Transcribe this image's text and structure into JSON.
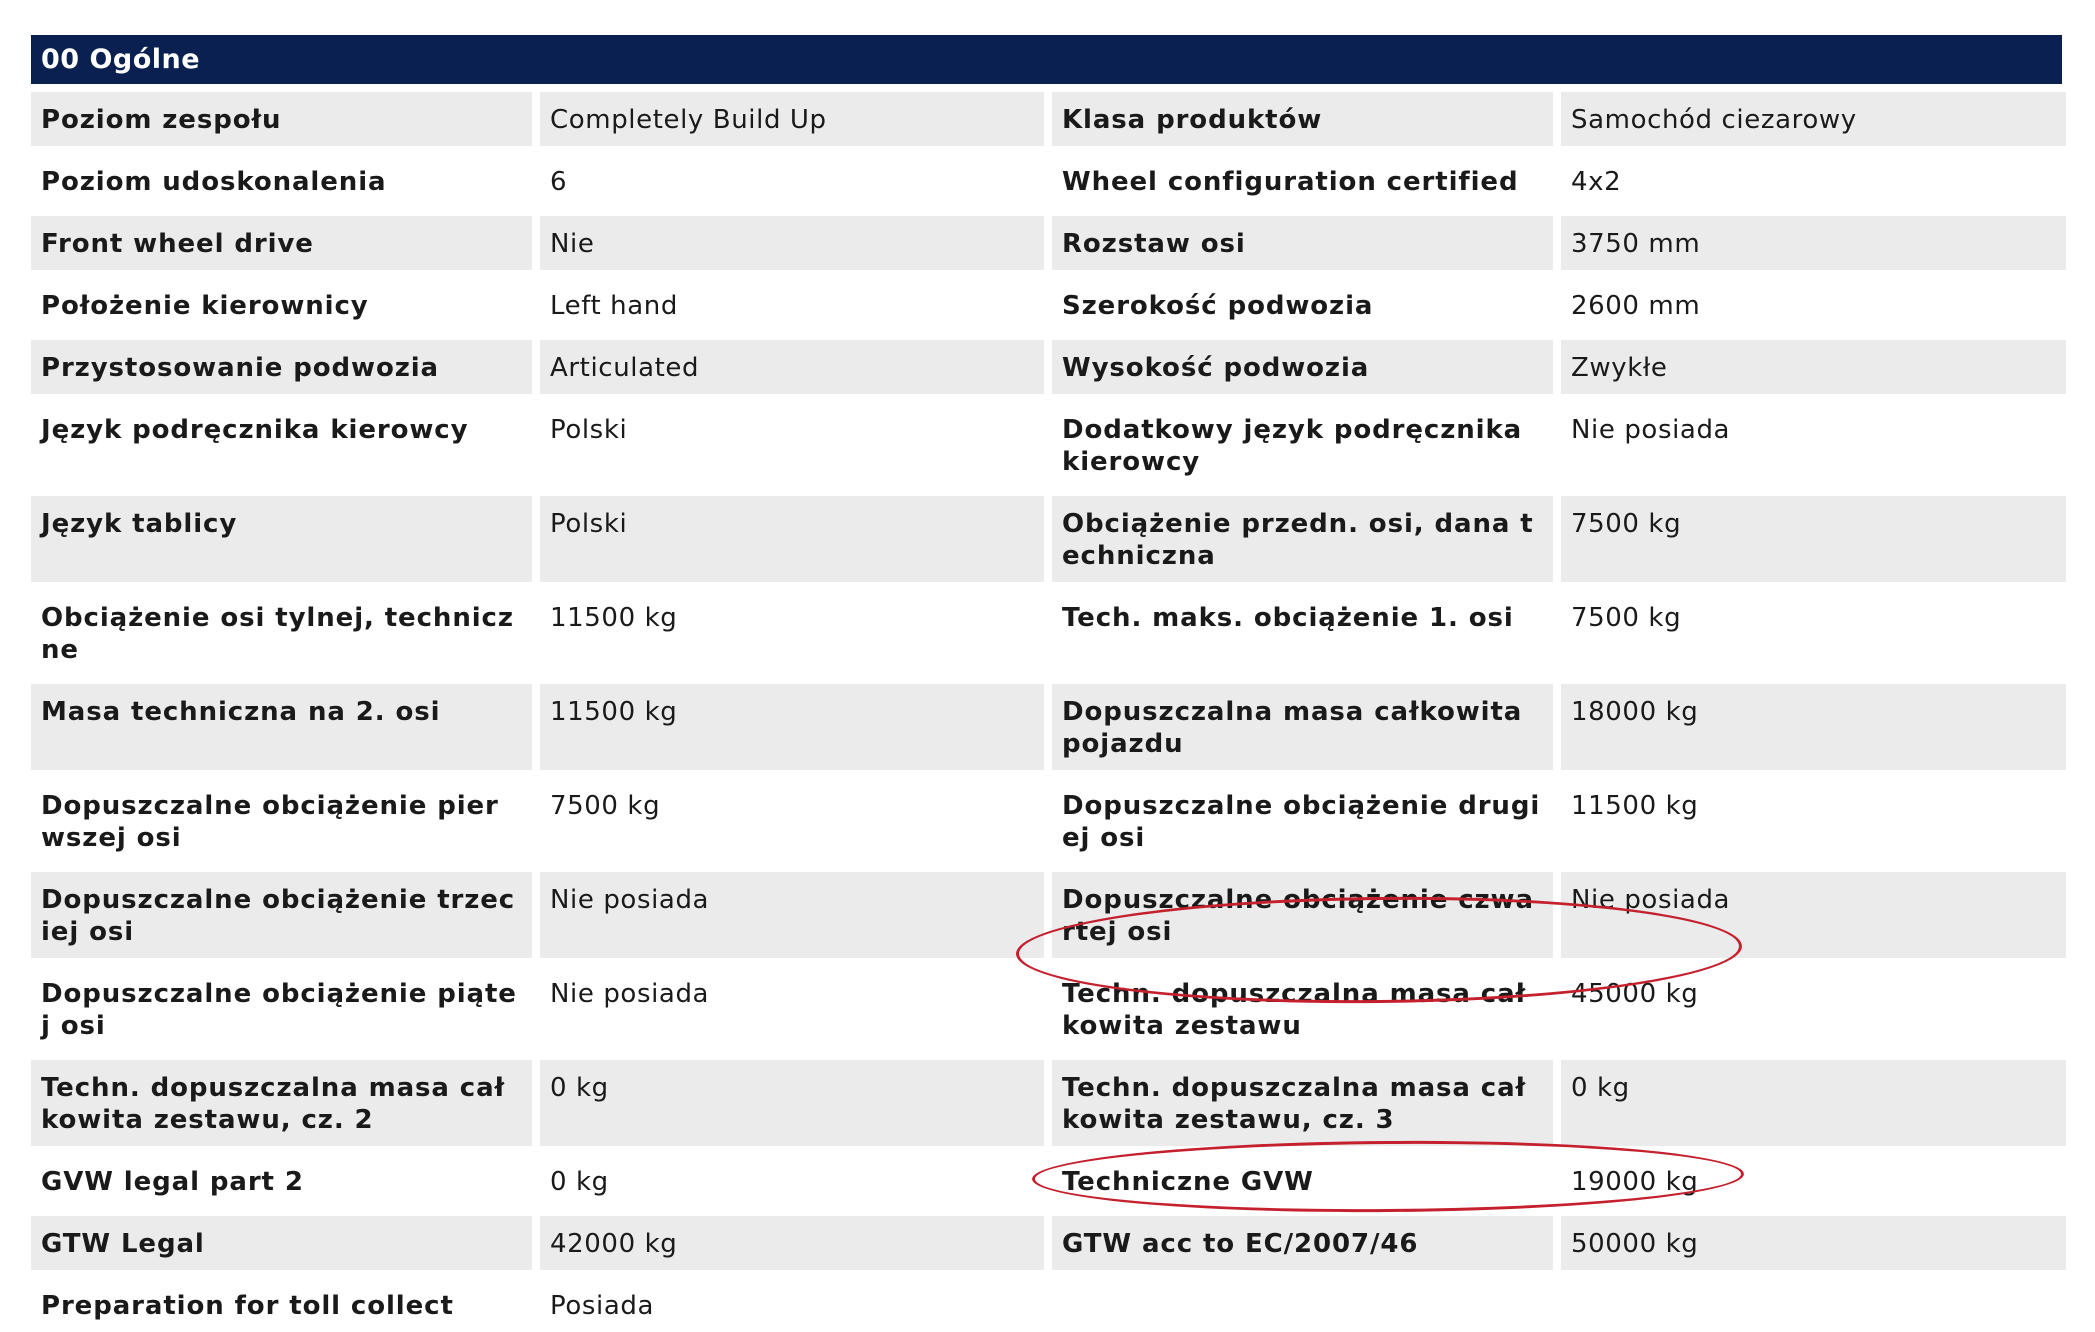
{
  "section": {
    "title": "00 Ogólne"
  },
  "rows": [
    {
      "l1": "Poziom zespołu",
      "v1": "Completely Build Up",
      "l2": "Klasa produktów",
      "v2": "Samochód ciezarowy"
    },
    {
      "l1": "Poziom udoskonalenia",
      "v1": "6",
      "l2": "Wheel configuration certified",
      "v2": "4x2"
    },
    {
      "l1": "Front wheel drive",
      "v1": "Nie",
      "l2": "Rozstaw osi",
      "v2": "3750 mm"
    },
    {
      "l1": "Położenie kierownicy",
      "v1": "Left hand",
      "l2": "Szerokość podwozia",
      "v2": "2600 mm"
    },
    {
      "l1": "Przystosowanie podwozia",
      "v1": "Articulated",
      "l2": "Wysokość podwozia",
      "v2": "Zwykłe"
    },
    {
      "l1": "Język podręcznika kierowcy",
      "v1": "Polski",
      "l2": "Dodatkowy język podręcznika kierowcy",
      "v2": "Nie posiada"
    },
    {
      "l1": "Język tablicy",
      "v1": "Polski",
      "l2": "Obciążenie przedn. osi, dana techniczna",
      "v2": "7500 kg"
    },
    {
      "l1": "Obciążenie osi tylnej, techniczne",
      "v1": "11500 kg",
      "l2": "Tech. maks. obciążenie 1. osi",
      "v2": "7500 kg"
    },
    {
      "l1": "Masa techniczna na 2. osi",
      "v1": "11500 kg",
      "l2": "Dopuszczalna masa całkowita pojazdu",
      "v2": "18000 kg"
    },
    {
      "l1": "Dopuszczalne obciążenie pierwszej osi",
      "v1": "7500 kg",
      "l2": "Dopuszczalne obciążenie drugiej osi",
      "v2": "11500 kg"
    },
    {
      "l1": "Dopuszczalne obciążenie trzeciej osi",
      "v1": "Nie posiada",
      "l2": "Dopuszczalne obciążenie czwartej osi",
      "v2": "Nie posiada"
    },
    {
      "l1": "Dopuszczalne obciążenie piątej osi",
      "v1": "Nie posiada",
      "l2": "Techn. dopuszczalna masa całkowita zestawu",
      "v2": "45000 kg"
    },
    {
      "l1": "Techn. dopuszczalna masa całkowita zestawu, cz. 2",
      "v1": "0 kg",
      "l2": "Techn. dopuszczalna masa całkowita zestawu, cz. 3",
      "v2": "0 kg"
    },
    {
      "l1": "GVW legal part 2",
      "v1": "0 kg",
      "l2": "Techniczne GVW",
      "v2": "19000 kg"
    },
    {
      "l1": "GTW Legal",
      "v1": "42000 kg",
      "l2": "GTW acc to EC/2007/46",
      "v2": "50000 kg"
    },
    {
      "l1": "Preparation for toll collect",
      "v1": "Posiada",
      "l2": "",
      "v2": ""
    }
  ],
  "highlight_color": "#c5202e",
  "header_color": "#0a2050",
  "row_shade_color": "#ebebeb"
}
